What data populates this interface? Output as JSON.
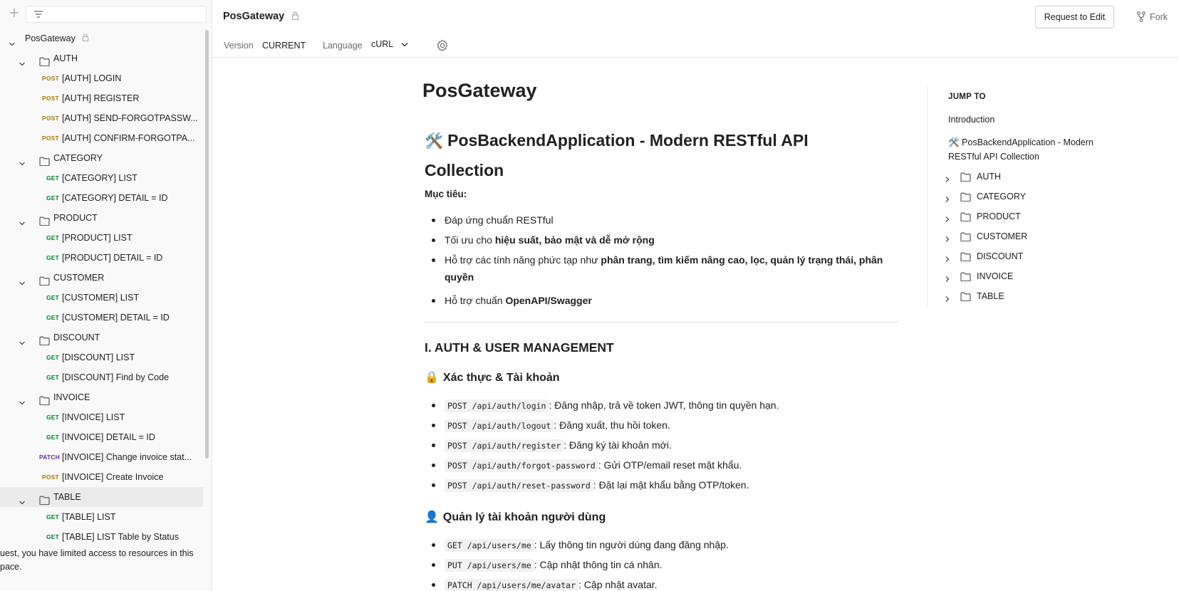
{
  "sidebar": {
    "plus_icon": "plus-icon",
    "filter_icon": "filter-icon",
    "root": {
      "label": "PosGateway"
    },
    "folders": [
      {
        "name": "AUTH",
        "items": [
          {
            "method": "POST",
            "label": "[AUTH] LOGIN"
          },
          {
            "method": "POST",
            "label": "[AUTH] REGISTER"
          },
          {
            "method": "POST",
            "label": "[AUTH] SEND-FORGOTPASSW..."
          },
          {
            "method": "POST",
            "label": "[AUTH] CONFIRM-FORGOTPA..."
          }
        ]
      },
      {
        "name": "CATEGORY",
        "items": [
          {
            "method": "GET",
            "label": "[CATEGORY] LIST"
          },
          {
            "method": "GET",
            "label": "[CATEGORY] DETAIL = ID"
          }
        ]
      },
      {
        "name": "PRODUCT",
        "items": [
          {
            "method": "GET",
            "label": "[PRODUCT] LIST"
          },
          {
            "method": "GET",
            "label": "[PRODUCT] DETAIL = ID"
          }
        ]
      },
      {
        "name": "CUSTOMER",
        "items": [
          {
            "method": "GET",
            "label": "[CUSTOMER] LIST"
          },
          {
            "method": "GET",
            "label": "[CUSTOMER] DETAIL = ID"
          }
        ]
      },
      {
        "name": "DISCOUNT",
        "items": [
          {
            "method": "GET",
            "label": "[DISCOUNT] LIST"
          },
          {
            "method": "GET",
            "label": "[DISCOUNT] Find by Code"
          }
        ]
      },
      {
        "name": "INVOICE",
        "items": [
          {
            "method": "GET",
            "label": "[INVOICE] LIST"
          },
          {
            "method": "GET",
            "label": "[INVOICE] DETAIL = ID"
          },
          {
            "method": "PATCH",
            "label": "[INVOICE] Change invoice stat..."
          },
          {
            "method": "POST",
            "label": "[INVOICE] Create Invoice"
          }
        ]
      },
      {
        "name": "TABLE",
        "selected": true,
        "items": [
          {
            "method": "GET",
            "label": "[TABLE] LIST"
          },
          {
            "method": "GET",
            "label": "[TABLE] LIST Table by Status"
          }
        ]
      }
    ],
    "guest_note": "uest, you have limited access to resources in this pace."
  },
  "header": {
    "title": "PosGateway",
    "request_edit": "Request to Edit",
    "fork": "Fork",
    "version_label": "Version",
    "version_value": "CURRENT",
    "language_label": "Language",
    "language_value": "cURL",
    "settings_icon": "gear-icon"
  },
  "doc": {
    "title": "PosGateway",
    "h2_emoji": "🛠️",
    "h2": "PosBackendApplication - Modern RESTful API Collection",
    "goal": "Mục tiêu:",
    "goals": [
      {
        "pre": "Đáp ứng chuẩn RESTful",
        "bold": "",
        "post": ""
      },
      {
        "pre": "Tối ưu cho ",
        "bold": "hiệu suất, bảo mật và dễ mở rộng",
        "post": ""
      },
      {
        "pre": "Hỗ trợ các tính năng phức tạp như ",
        "bold": "phân trang, tìm kiếm nâng cao, lọc, quản lý trạng thái, phân quyền",
        "post": ""
      },
      {
        "pre": "Hỗ trợ chuẩn ",
        "bold": "OpenAPI/Swagger",
        "post": ""
      }
    ],
    "section1": "I. AUTH & USER MANAGEMENT",
    "sub1_emoji": "🔒",
    "sub1": "Xác thực & Tài khoản",
    "auth_endpoints": [
      {
        "code": "POST /api/auth/login",
        "desc": ": Đăng nhập, trả về token JWT, thông tin quyền hạn."
      },
      {
        "code": "POST /api/auth/logout",
        "desc": ": Đăng xuất, thu hồi token."
      },
      {
        "code": "POST /api/auth/register",
        "desc": ": Đăng ký tài khoản mới."
      },
      {
        "code": "POST /api/auth/forgot-password",
        "desc": ": Gửi OTP/email reset mật khẩu."
      },
      {
        "code": "POST /api/auth/reset-password",
        "desc": ": Đặt lại mật khẩu bằng OTP/token."
      }
    ],
    "sub2_emoji": "👤",
    "sub2": "Quản lý tài khoản người dùng",
    "user_endpoints": [
      {
        "code": "GET /api/users/me",
        "desc": ": Lấy thông tin người dùng đang đăng nhập."
      },
      {
        "code": "PUT /api/users/me",
        "desc": ": Cập nhật thông tin cá nhân."
      },
      {
        "code": "PATCH /api/users/me/avatar",
        "desc": ": Cập nhật avatar."
      }
    ]
  },
  "jump": {
    "heading": "JUMP TO",
    "intro": "Introduction",
    "h2_link": "🛠️ PosBackendApplication - Modern RESTful API Collection",
    "folders": [
      "AUTH",
      "CATEGORY",
      "PRODUCT",
      "CUSTOMER",
      "DISCOUNT",
      "INVOICE",
      "TABLE"
    ]
  }
}
